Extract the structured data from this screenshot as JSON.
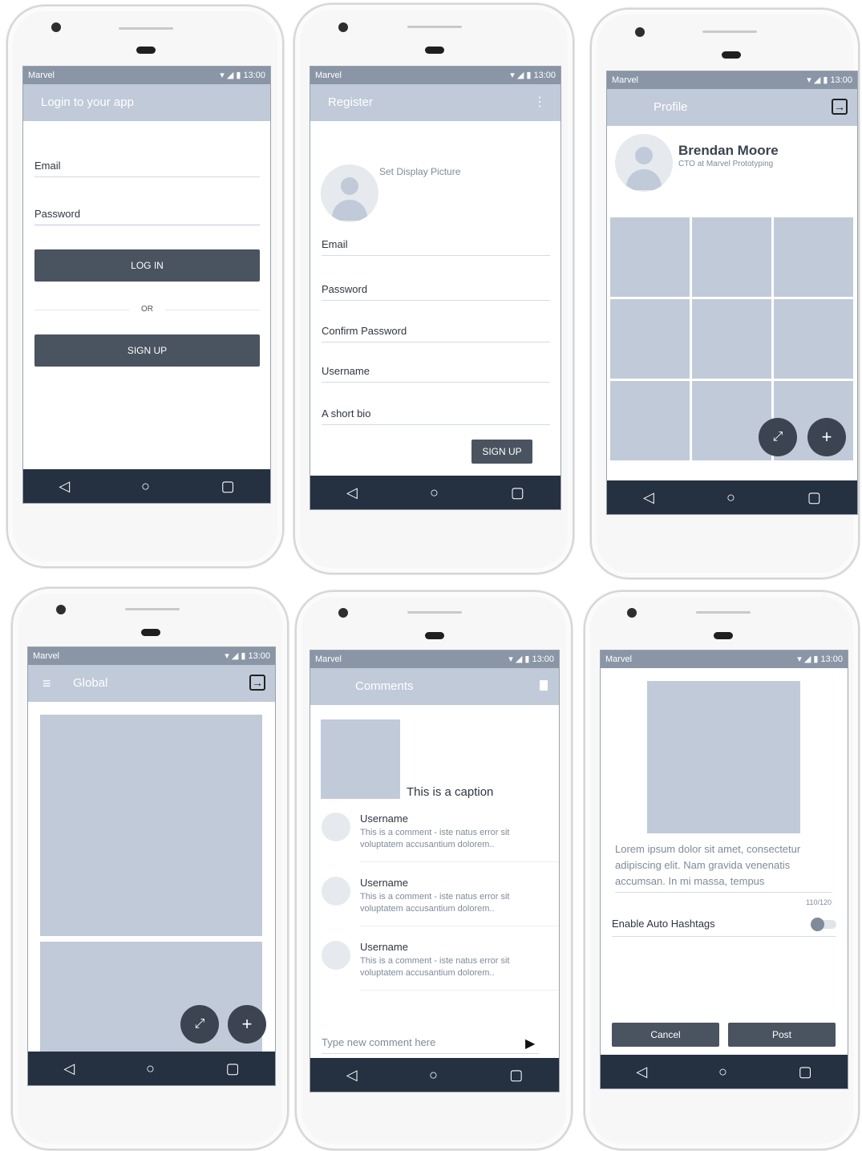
{
  "status": {
    "carrier": "Marvel",
    "time": "13:00"
  },
  "login": {
    "title": "Login to your app",
    "email_label": "Email",
    "password_label": "Password",
    "login_button": "LOG IN",
    "or_text": "OR",
    "signup_button": "SIGN UP"
  },
  "register": {
    "title": "Register",
    "set_picture": "Set Display Picture",
    "email_label": "Email",
    "password_label": "Password",
    "confirm_label": "Confirm Password",
    "username_label": "Username",
    "bio_label": "A short bio",
    "signup_button": "SIGN UP"
  },
  "profile": {
    "title": "Profile",
    "name": "Brendan Moore",
    "subtitle": "CTO at Marvel Prototyping"
  },
  "global": {
    "title": "Global"
  },
  "comments": {
    "title": "Comments",
    "caption": "This is a caption",
    "items": [
      {
        "username": "Username",
        "text": "This is a comment - iste natus error sit voluptatem accusantium dolorem.."
      },
      {
        "username": "Username",
        "text": "This is a comment - iste natus error sit voluptatem accusantium dolorem.."
      },
      {
        "username": "Username",
        "text": "This is a comment - iste natus error sit voluptatem accusantium dolorem.."
      }
    ],
    "input_placeholder": "Type new comment here"
  },
  "post": {
    "body": "Lorem ipsum dolor sit amet, consectetur adipiscing elit. Nam gravida venenatis accumsan. In mi massa, tempus",
    "counter": "110/120",
    "toggle_label": "Enable Auto Hashtags",
    "toggle_on": false,
    "cancel_button": "Cancel",
    "post_button": "Post"
  },
  "colors": {
    "appbar": "#c1cad8",
    "statusbar": "#8a96a6",
    "navbar": "#253040",
    "button": "#4a5360"
  }
}
